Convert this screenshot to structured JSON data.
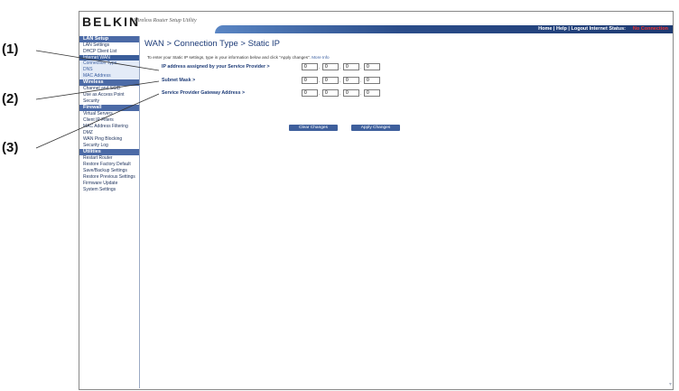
{
  "callouts": [
    "(1)",
    "(2)",
    "(3)"
  ],
  "brand": {
    "logo": "BELKIN",
    "tagline": "Wireless Router Setup Utility"
  },
  "topbar": {
    "links": "Home | Help | Logout   Internet Status:",
    "status_value": "No Connection"
  },
  "sidebar": {
    "lan_setup": {
      "title": "LAN Setup",
      "items": [
        "LAN Settings",
        "DHCP Client List"
      ]
    },
    "internet_wan": {
      "title": "Internet WAN",
      "items": [
        "Connection Type",
        "DNS",
        "MAC Address"
      ]
    },
    "wireless": {
      "title": "Wireless",
      "items": [
        "Channel and SSID",
        "Use as Access Point",
        "Security"
      ]
    },
    "firewall": {
      "title": "Firewall",
      "items": [
        "Virtual Servers",
        "Client IP Filters",
        "MAC Address Filtering",
        "DMZ",
        "WAN Ping Blocking",
        "Security Log"
      ]
    },
    "utilities": {
      "title": "Utilities",
      "items": [
        "Restart Router",
        "Restore Factory Default",
        "Save/Backup Settings",
        "Restore Previous Settings",
        "Firmware Update",
        "System Settings"
      ]
    }
  },
  "main": {
    "title": "WAN > Connection Type > Static IP",
    "instructions": "To enter your Static IP settings, type in your information below and click \"Apply changes\".",
    "more_info": "More Info",
    "fields": {
      "ip": {
        "label": "IP address assigned by your Service Provider >",
        "octets": [
          "0",
          "0",
          "0",
          "0"
        ]
      },
      "subnet": {
        "label": "Subnet Mask >",
        "octets": [
          "0",
          "0",
          "0",
          "0"
        ]
      },
      "gateway": {
        "label": "Service Provider Gateway Address >",
        "octets": [
          "0",
          "0",
          "0",
          "0"
        ]
      }
    },
    "buttons": {
      "clear": "Clear Changes",
      "apply": "Apply Changes"
    }
  },
  "icons": {
    "scroll": "scroll-down-arrow-icon"
  }
}
